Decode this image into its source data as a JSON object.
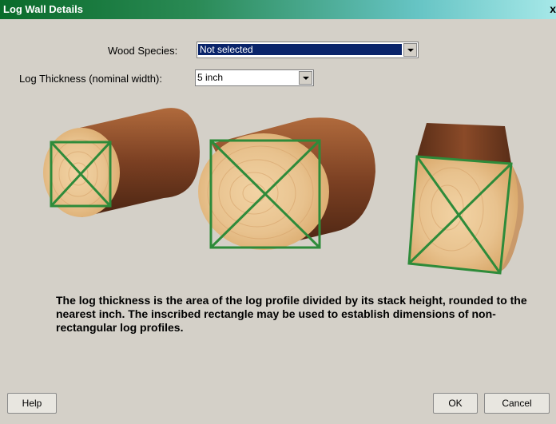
{
  "window": {
    "title": "Log Wall Details",
    "close_glyph": "x"
  },
  "form": {
    "wood_species_label": "Wood Species:",
    "wood_species_value": "Not selected",
    "log_thickness_label": "Log Thickness (nominal width):",
    "log_thickness_value": "5 inch"
  },
  "illustration": {
    "logs": [
      "round-log",
      "large-round-log",
      "squared-log"
    ],
    "colors": {
      "bark": "#7a3f22",
      "end_grain": "#e8c28e",
      "inscribed_rectangle": "#2e8b3a"
    }
  },
  "description": "The log thickness is the area of the log profile divided by its stack height, rounded to the nearest inch.  The inscribed rectangle may be used to establish dimensions of non-rectangular log profiles.",
  "buttons": {
    "help": "Help",
    "ok": "OK",
    "cancel": "Cancel"
  }
}
